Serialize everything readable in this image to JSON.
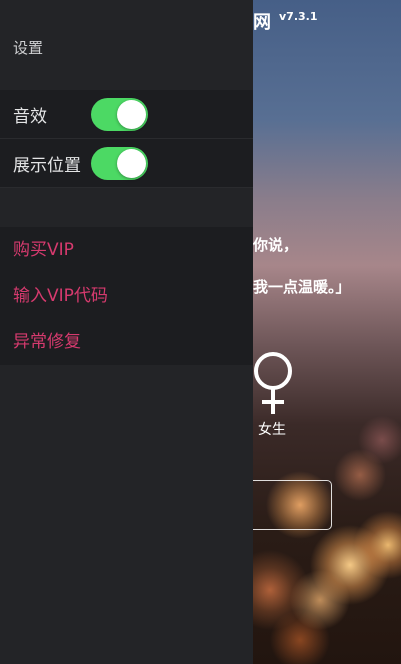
{
  "background": {
    "title_fragment": "网",
    "version": "v7.3.1",
    "message_line1": "你说，",
    "message_line2": "我一点温暖。」",
    "gender_label": "女生"
  },
  "drawer": {
    "header": "设置",
    "settings": [
      {
        "label": "音效",
        "enabled": true
      },
      {
        "label": "展示位置",
        "enabled": true
      }
    ],
    "menu": [
      {
        "label": "购买VIP"
      },
      {
        "label": "输入VIP代码"
      },
      {
        "label": "异常修复"
      }
    ]
  },
  "colors": {
    "switch_on": "#4cd964",
    "menu_text": "#d63a6e",
    "drawer_bg": "#232427"
  },
  "icons": {
    "gender": "female-symbol-icon"
  }
}
